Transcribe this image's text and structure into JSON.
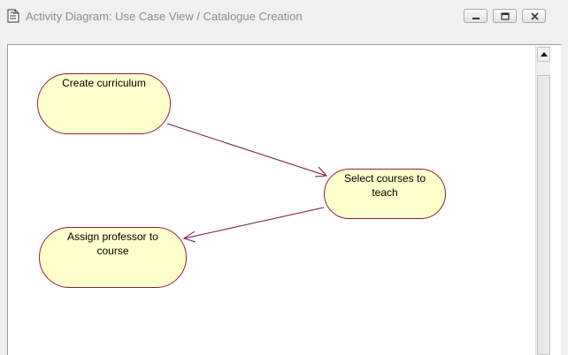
{
  "window": {
    "title": "Activity Diagram: Use Case View / Catalogue Creation",
    "icon": "document-page-icon",
    "buttons": [
      "minimize-icon",
      "restore-icon",
      "close-icon"
    ]
  },
  "diagram": {
    "activities": [
      {
        "id": "create",
        "label": "Create curriculum"
      },
      {
        "id": "select",
        "label": "Select courses to teach"
      },
      {
        "id": "assign",
        "label": "Assign professor to course"
      }
    ],
    "transitions": [
      {
        "from": "create",
        "to": "select"
      },
      {
        "from": "select",
        "to": "assign"
      }
    ]
  },
  "colors": {
    "node_fill": "#ffffcc",
    "node_border": "#8b1f3f",
    "edge": "#7a1545"
  }
}
